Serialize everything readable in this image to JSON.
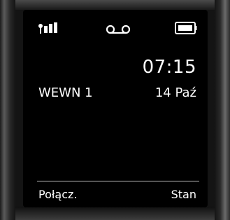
{
  "status_bar": {
    "icons": [
      "signal-strength-icon",
      "voicemail-icon",
      "battery-icon"
    ]
  },
  "idle": {
    "time": "07:15",
    "handset_name": "WEWN 1",
    "date": "14 Paź"
  },
  "softkeys": {
    "left_label": "Połącz.",
    "right_label": "Stan"
  },
  "colors": {
    "screen_bg": "#000000",
    "text": "#ffffff",
    "divider": "#bdbdbd"
  }
}
